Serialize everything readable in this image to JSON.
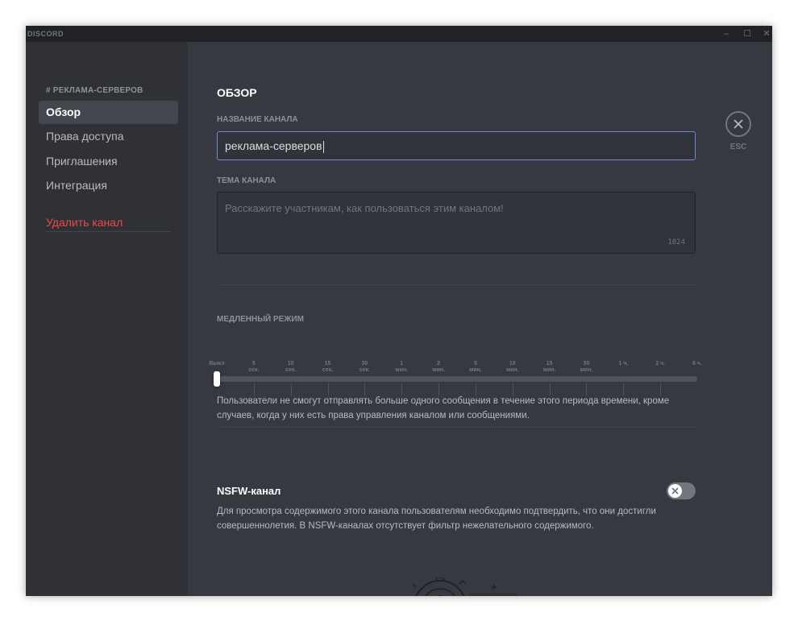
{
  "app": {
    "brand": "DISCORD"
  },
  "window_controls": {
    "minimize": "–",
    "maximize": "☐",
    "close": "✕"
  },
  "sidebar": {
    "header": "# РЕКЛАМА-СЕРВЕРОВ",
    "items": [
      {
        "label": "Обзор",
        "selected": true
      },
      {
        "label": "Права доступа"
      },
      {
        "label": "Приглашения"
      },
      {
        "label": "Интеграция"
      }
    ],
    "delete_label": "Удалить канал"
  },
  "main": {
    "title": "ОБЗОР",
    "channel_name": {
      "label": "НАЗВАНИЕ КАНАЛА",
      "value": "реклама-серверов"
    },
    "topic": {
      "label": "ТЕМА КАНАЛА",
      "placeholder": "Расскажите участникам, как пользоваться этим каналом!",
      "counter": "1024"
    },
    "slowmode": {
      "label": "МЕДЛЕННЫЙ РЕЖИМ",
      "marks": [
        {
          "value": "Выкл",
          "unit": ""
        },
        {
          "value": "5",
          "unit": "сек."
        },
        {
          "value": "10",
          "unit": "сек."
        },
        {
          "value": "15",
          "unit": "сек."
        },
        {
          "value": "30",
          "unit": "сек."
        },
        {
          "value": "1",
          "unit": "мин."
        },
        {
          "value": "2",
          "unit": "мин."
        },
        {
          "value": "5",
          "unit": "мин."
        },
        {
          "value": "10",
          "unit": "мин."
        },
        {
          "value": "15",
          "unit": "мин."
        },
        {
          "value": "30",
          "unit": "мин."
        },
        {
          "value": "1 ч.",
          "unit": ""
        },
        {
          "value": "2 ч.",
          "unit": ""
        },
        {
          "value": "6 ч.",
          "unit": ""
        }
      ],
      "selected": "Выкл",
      "description": "Пользователи не смогут отправлять больше одного сообщения в течение этого периода времени, кроме случаев, когда у них есть права управления каналом или сообщениями."
    },
    "nsfw": {
      "title": "NSFW-канал",
      "enabled": false,
      "description": "Для просмотра содержимого этого канала пользователям необходимо подтвердить, что они достигли совершеннолетия. В NSFW-каналах отсутствует фильтр нежелательного содержимого."
    },
    "esc_label": "ESC"
  },
  "colors": {
    "accent": "#7289da",
    "danger": "#f04747",
    "background": "#36393f",
    "sidebar": "#2f3136"
  }
}
